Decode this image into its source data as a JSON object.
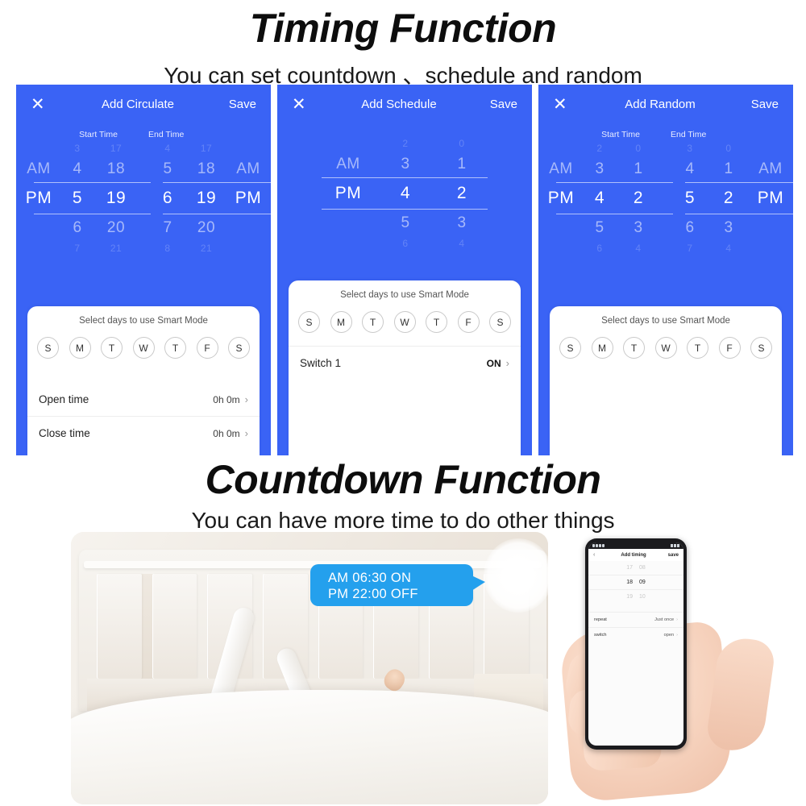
{
  "sections": [
    {
      "title": "Timing Function",
      "subtitle": "You can set countdown 、schedule and random"
    },
    {
      "title": "Countdown Function",
      "subtitle": "You can have more time to do other things"
    }
  ],
  "colors": {
    "panel_blue": "#3A63F5",
    "bubble_blue": "#24A0ED"
  },
  "panels": [
    {
      "close_icon": "close-icon",
      "title": "Add Circulate",
      "save_label": "Save",
      "picker": {
        "has_range_labels": true,
        "start_label": "Start Time",
        "end_label": "End Time",
        "start": {
          "faint_top": [
            "",
            "3",
            "17"
          ],
          "above": [
            "AM",
            "4",
            "18"
          ],
          "selected": [
            "PM",
            "5",
            "19"
          ],
          "below": [
            "",
            "6",
            "20"
          ],
          "faint_bottom": [
            "",
            "7",
            "21"
          ]
        },
        "end": {
          "faint_top": [
            "4",
            "17",
            ""
          ],
          "above": [
            "5",
            "18",
            "AM"
          ],
          "selected": [
            "6",
            "19",
            "PM"
          ],
          "below": [
            "7",
            "20",
            ""
          ],
          "faint_bottom": [
            "8",
            "21",
            ""
          ]
        }
      },
      "card": {
        "title": "Select days to use Smart Mode",
        "days": [
          "S",
          "M",
          "T",
          "W",
          "T",
          "F",
          "S"
        ],
        "rows": [
          {
            "label": "Open time",
            "value": "0h 0m",
            "chevron": "chevron-right-icon"
          },
          {
            "label": "Close time",
            "value": "0h 0m",
            "chevron": "chevron-right-icon"
          }
        ]
      }
    },
    {
      "close_icon": "close-icon",
      "title": "Add Schedule",
      "save_label": "Save",
      "picker": {
        "has_range_labels": false,
        "single": {
          "faint_top": [
            "",
            "2",
            "0"
          ],
          "above": [
            "AM",
            "3",
            "1"
          ],
          "selected": [
            "PM",
            "4",
            "2"
          ],
          "below": [
            "",
            "5",
            "3"
          ],
          "faint_bottom": [
            "",
            "6",
            "4"
          ]
        }
      },
      "card": {
        "title": "Select days to use Smart Mode",
        "days": [
          "S",
          "M",
          "T",
          "W",
          "T",
          "F",
          "S"
        ],
        "rows": [
          {
            "label": "Switch 1",
            "value": "ON",
            "chevron": "chevron-right-icon"
          }
        ]
      }
    },
    {
      "close_icon": "close-icon",
      "title": "Add Random",
      "save_label": "Save",
      "picker": {
        "has_range_labels": true,
        "start_label": "Start Time",
        "end_label": "End Time",
        "start": {
          "faint_top": [
            "",
            "2",
            "0"
          ],
          "above": [
            "AM",
            "3",
            "1"
          ],
          "selected": [
            "PM",
            "4",
            "2"
          ],
          "below": [
            "",
            "5",
            "3"
          ],
          "faint_bottom": [
            "",
            "6",
            "4"
          ]
        },
        "end": {
          "faint_top": [
            "3",
            "0",
            ""
          ],
          "above": [
            "4",
            "1",
            "AM"
          ],
          "selected": [
            "5",
            "2",
            "PM"
          ],
          "below": [
            "6",
            "3",
            ""
          ],
          "faint_bottom": [
            "7",
            "4",
            ""
          ]
        }
      },
      "card": {
        "title": "Select days to use Smart Mode",
        "days": [
          "S",
          "M",
          "T",
          "W",
          "T",
          "F",
          "S"
        ],
        "rows": []
      }
    }
  ],
  "photo": {
    "bubble": {
      "line1": "AM 06:30 ON",
      "line2": "PM 22:00 OFF"
    },
    "phone": {
      "back_icon": "chevron-left-icon",
      "title": "Add timing",
      "save_label": "save",
      "times": [
        {
          "hour": "17",
          "minute": "08",
          "selected": false
        },
        {
          "hour": "18",
          "minute": "09",
          "selected": true
        },
        {
          "hour": "19",
          "minute": "10",
          "selected": false
        }
      ],
      "rows": [
        {
          "label": "repeat",
          "value": "Just once",
          "chevron": "chevron-right-icon"
        },
        {
          "label": "switch",
          "value": "open",
          "chevron": "chevron-right-icon"
        }
      ]
    }
  }
}
